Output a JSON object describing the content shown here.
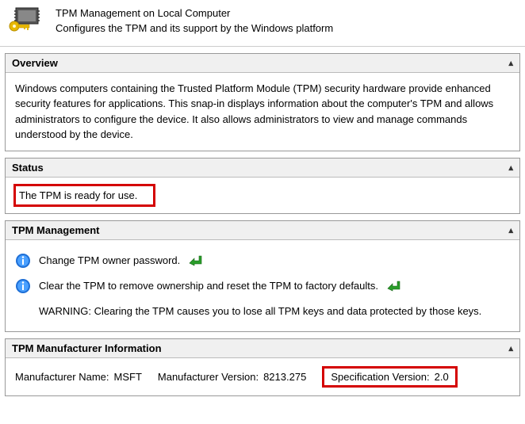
{
  "header": {
    "title": "TPM Management on Local Computer",
    "subtitle": "Configures the TPM and its support by the Windows platform"
  },
  "overview": {
    "title": "Overview",
    "body": "Windows computers containing the Trusted Platform Module (TPM) security hardware provide enhanced security features for applications. This snap-in displays information about the computer's TPM and allows administrators to configure the device. It also allows administrators to view and manage commands understood by the device."
  },
  "status": {
    "title": "Status",
    "text": "The TPM is ready for use."
  },
  "mgmt": {
    "title": "TPM Management",
    "change_password": "Change TPM owner password.",
    "clear_tpm": "Clear the TPM to remove ownership and reset the TPM to factory defaults.",
    "warning": "WARNING: Clearing the TPM causes you to lose all TPM keys and data protected by those keys."
  },
  "mfr": {
    "title": "TPM Manufacturer Information",
    "name_label": "Manufacturer Name:",
    "name_value": "MSFT",
    "version_label": "Manufacturer Version:",
    "version_value": "8213.275",
    "spec_label": "Specification Version:",
    "spec_value": "2.0"
  }
}
